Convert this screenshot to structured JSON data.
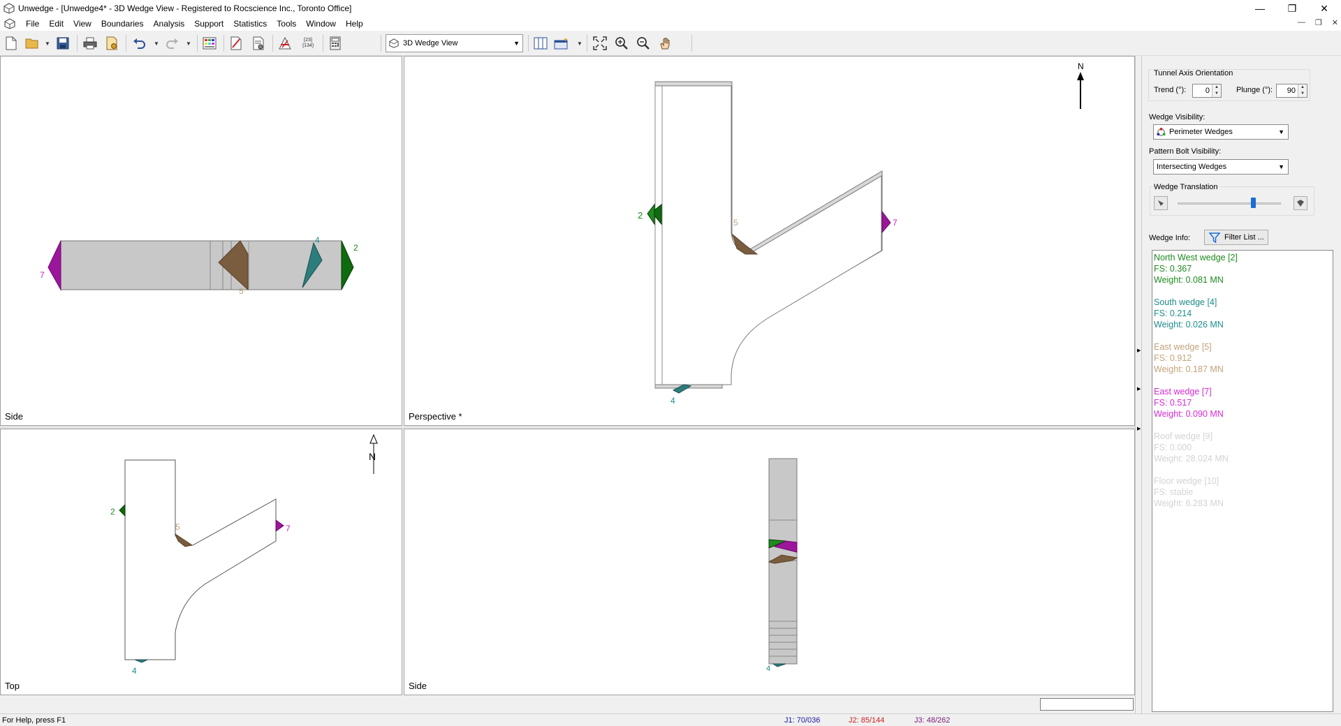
{
  "window": {
    "title": "Unwedge - [Unwedge4* - 3D Wedge View - Registered to Rocscience Inc., Toronto Office]",
    "minimize": "—",
    "maximize": "❐",
    "close": "✕"
  },
  "menu": [
    "File",
    "Edit",
    "View",
    "Boundaries",
    "Analysis",
    "Support",
    "Statistics",
    "Tools",
    "Window",
    "Help"
  ],
  "toolbar": {
    "view_select": "3D Wedge View",
    "stats_icon_text_top": "{23}",
    "stats_icon_text_bottom": "{134}"
  },
  "panes": {
    "side_top": "Side",
    "perspective": "Perspective *",
    "top": "Top",
    "side_bottom": "Side"
  },
  "wedge_labels": {
    "w2": "2",
    "w4": "4",
    "w5": "5",
    "w7": "7"
  },
  "north_label": "N",
  "panel": {
    "tunnel_axis_title": "Tunnel Axis Orientation",
    "trend_label": "Trend (°):",
    "trend_value": "0",
    "plunge_label": "Plunge (°):",
    "plunge_value": "90",
    "wedge_visibility_label": "Wedge Visibility:",
    "wedge_visibility_value": "Perimeter Wedges",
    "bolt_visibility_label": "Pattern Bolt Visibility:",
    "bolt_visibility_value": "Intersecting Wedges",
    "translation_label": "Wedge Translation",
    "translation_level": 0.73,
    "wedge_info_label": "Wedge Info:",
    "filter_button": "Filter List ..."
  },
  "wedges": [
    {
      "name": "North West wedge [2]",
      "fs": "FS: 0.367",
      "weight": "Weight: 0.081 MN",
      "color": "#1f8a1f"
    },
    {
      "name": "South wedge [4]",
      "fs": "FS: 0.214",
      "weight": "Weight: 0.026 MN",
      "color": "#1f8b8b"
    },
    {
      "name": "East wedge [5]",
      "fs": "FS: 0.912",
      "weight": "Weight: 0.187 MN",
      "color": "#c2a27a"
    },
    {
      "name": "East wedge [7]",
      "fs": "FS: 0.517",
      "weight": "Weight: 0.090 MN",
      "color": "#d62ad6"
    },
    {
      "name": "Roof wedge [9]",
      "fs": "FS: 0.000",
      "weight": "Weight: 28.024 MN",
      "color": "#d3d3d3"
    },
    {
      "name": "Floor wedge [10]",
      "fs": "FS: stable",
      "weight": "Weight: 6.283 MN",
      "color": "#d3d3d3"
    }
  ],
  "status": {
    "help": "For Help, press F1",
    "j1": "J1: 70/036",
    "j2": "J2: 85/144",
    "j3": "J3: 48/262"
  },
  "colors": {
    "j1": "#1a1aa6",
    "j2": "#c81e1e",
    "j3": "#7a1a7a",
    "tunnel_fill": "#c8c8c8",
    "wedge2": "#0f6b0f",
    "wedge4": "#2e7d7d",
    "wedge5": "#7a5c3e",
    "wedge7": "#9c169c"
  }
}
